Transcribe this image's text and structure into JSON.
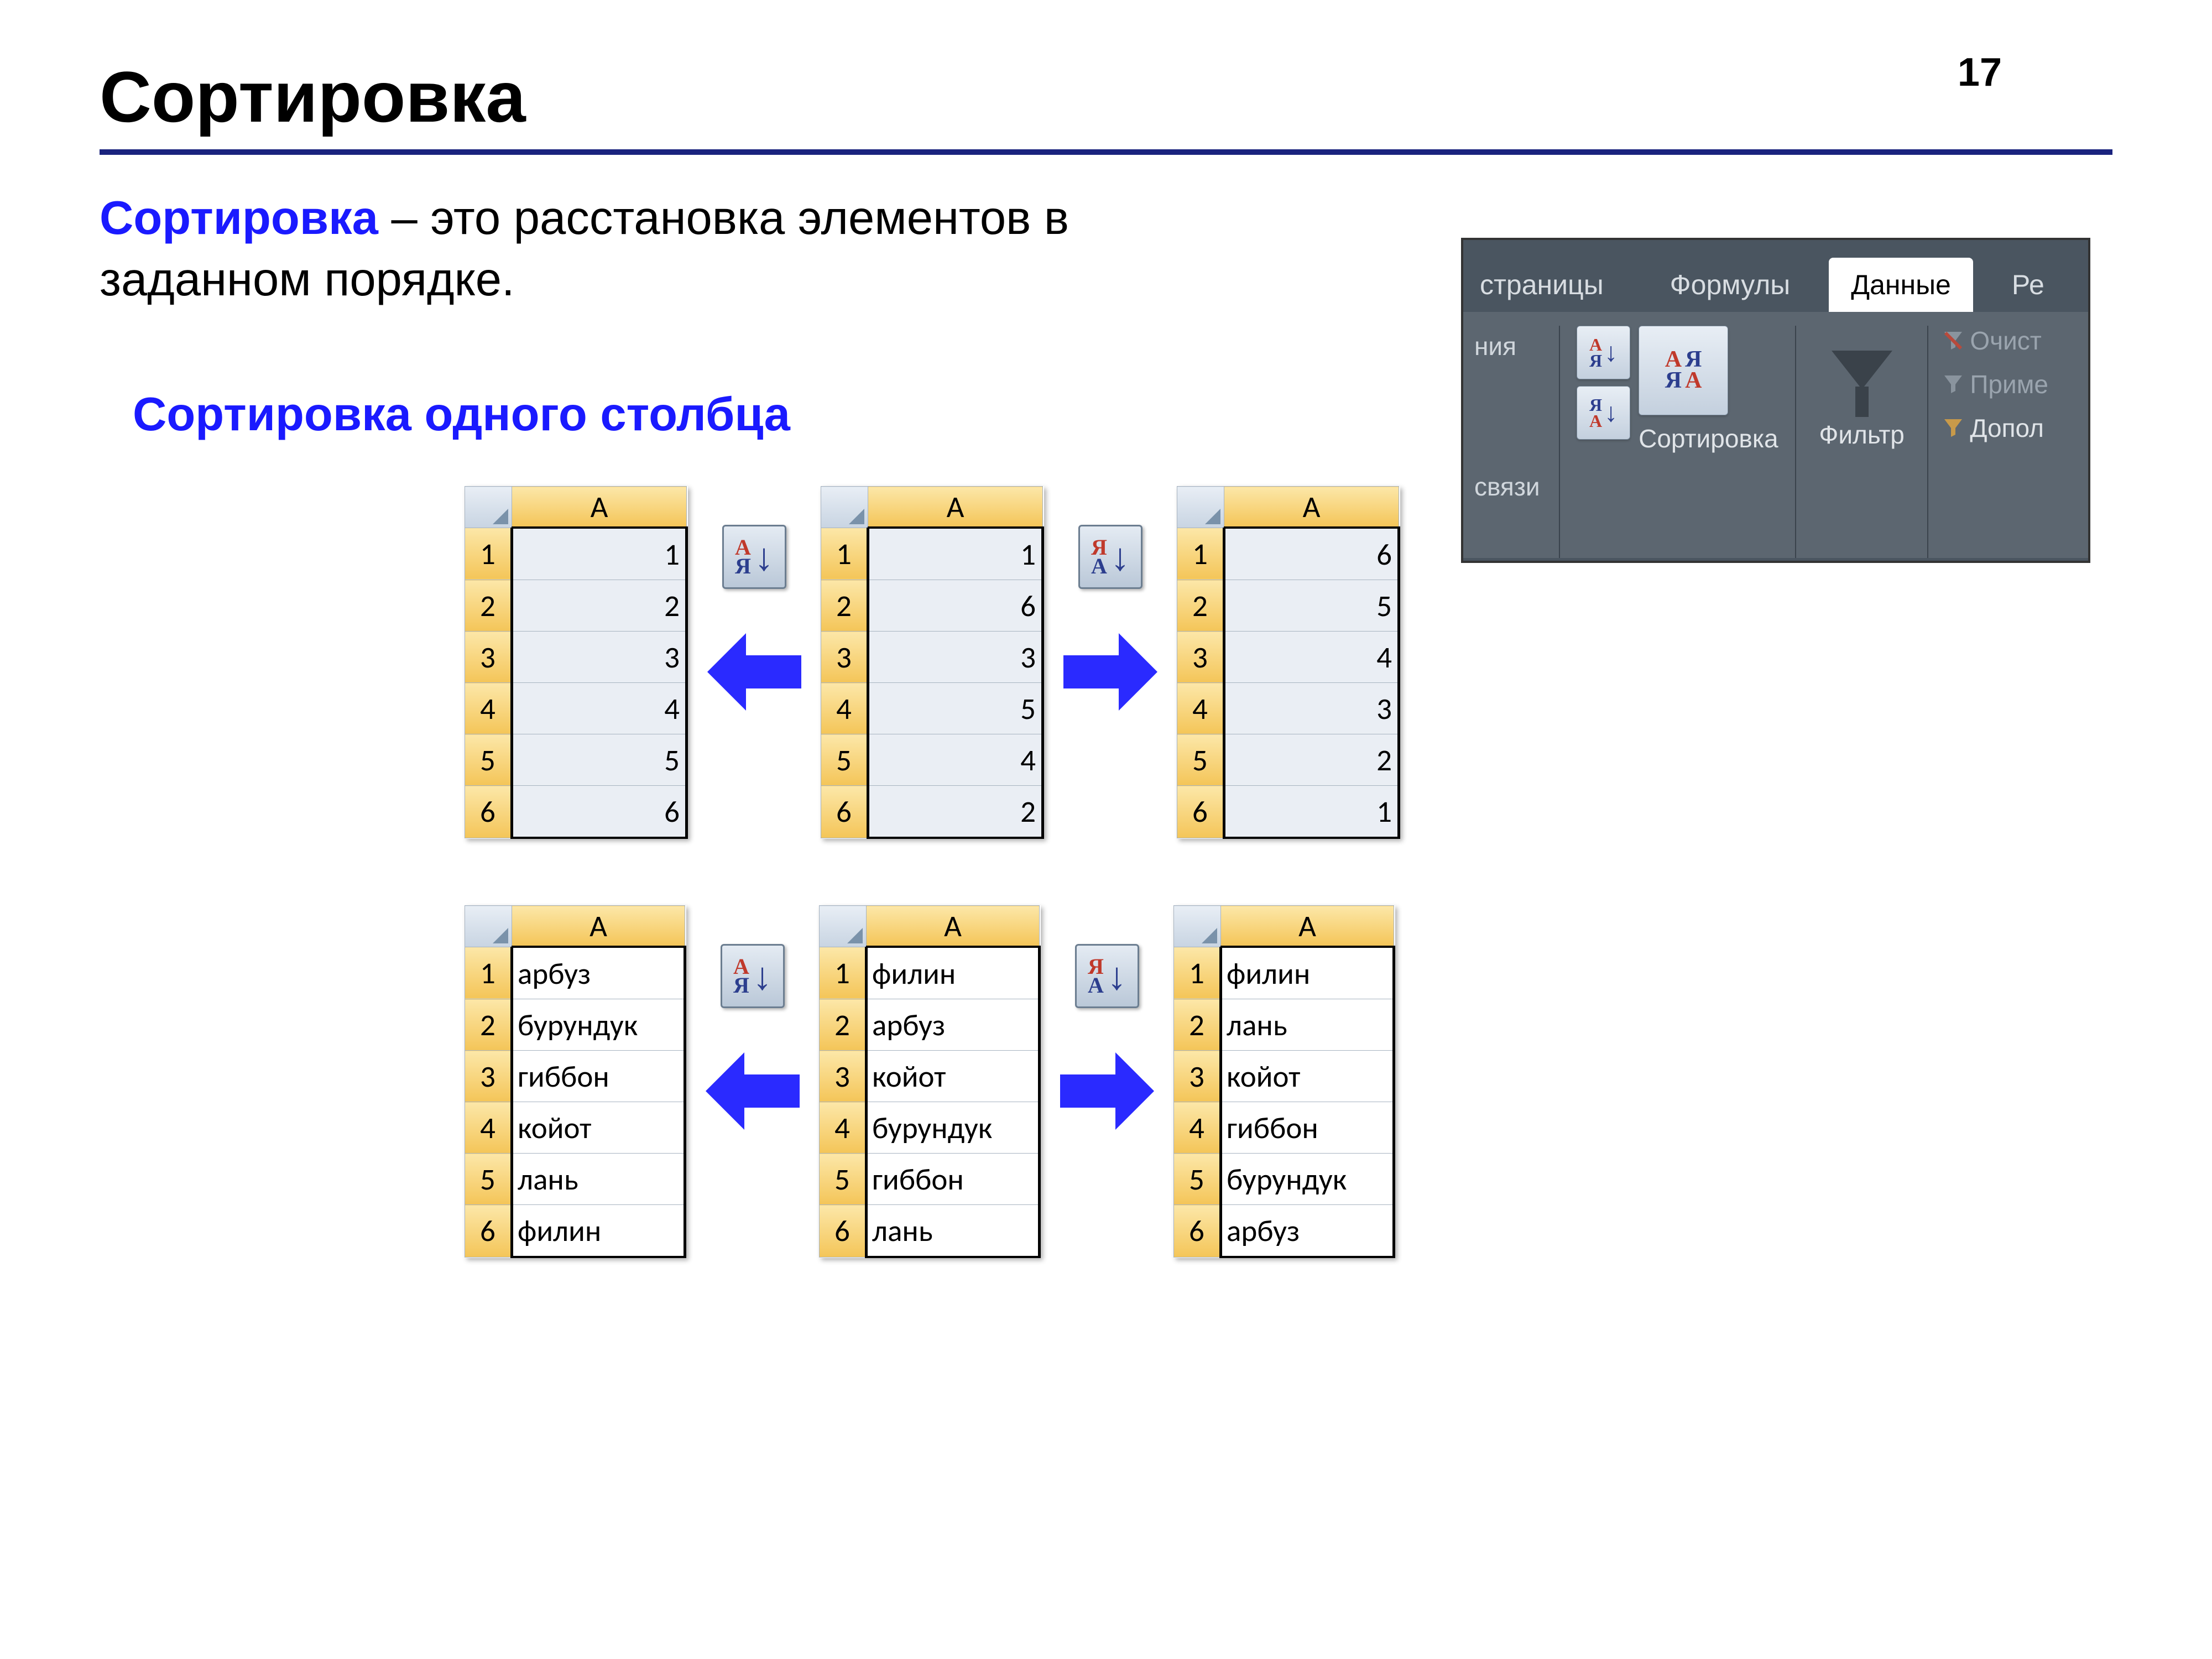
{
  "page_number": "17",
  "title": "Сортировка",
  "definition_term": "Сортировка",
  "definition_rest": " – это расстановка элементов в заданном порядке.",
  "subtitle": "Сортировка одного столбца",
  "ribbon": {
    "tab_left": "страницы",
    "tab_formulas": "Формулы",
    "tab_data": "Данные",
    "tab_right": "Ре",
    "conn_label": "ния",
    "links_label": "связи",
    "sort_label": "Сортировка",
    "filter_label": "Фильтр",
    "clear": "Очист",
    "apply": "Приме",
    "advanced": "Допол"
  },
  "col_header": "A",
  "rows": [
    "1",
    "2",
    "3",
    "4",
    "5",
    "6"
  ],
  "num_sorted_asc": [
    "1",
    "2",
    "3",
    "4",
    "5",
    "6"
  ],
  "num_unsorted": [
    "1",
    "6",
    "3",
    "5",
    "4",
    "2"
  ],
  "num_sorted_desc": [
    "6",
    "5",
    "4",
    "3",
    "2",
    "1"
  ],
  "txt_sorted_asc": [
    "арбуз",
    "бурундук",
    "гиббон",
    "койот",
    "лань",
    "филин"
  ],
  "txt_unsorted": [
    "филин",
    "арбуз",
    "койот",
    "бурундук",
    "гиббон",
    "лань"
  ],
  "txt_sorted_desc": [
    "филин",
    "лань",
    "койот",
    "гиббон",
    "бурундук",
    "арбуз"
  ]
}
